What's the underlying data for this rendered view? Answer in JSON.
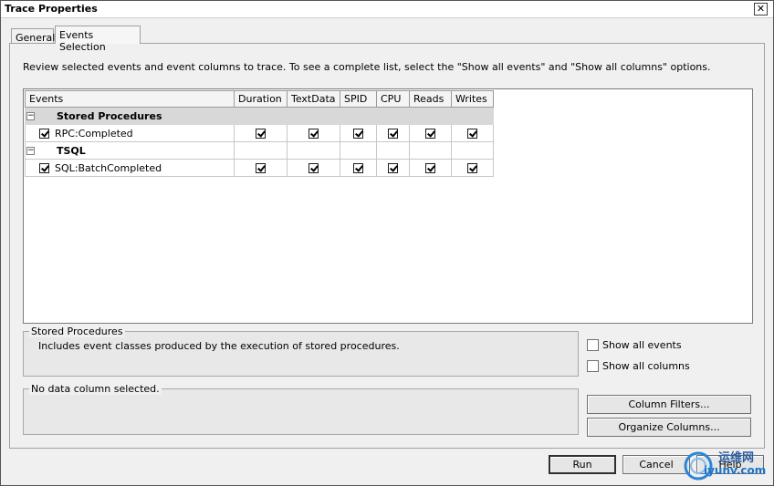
{
  "window": {
    "title": "Trace Properties",
    "close_glyph": "✕"
  },
  "tabs": [
    {
      "label": "General"
    },
    {
      "label": "Events Selection"
    }
  ],
  "intro_text": "Review selected events and event columns to trace. To see a complete list, select the \"Show all events\" and \"Show all columns\" options.",
  "grid": {
    "columns": [
      "Events",
      "Duration",
      "TextData",
      "SPID",
      "CPU",
      "Reads",
      "Writes"
    ],
    "groups": [
      {
        "label": "Stored Procedures",
        "collapse_glyph": "−",
        "events": [
          {
            "label": "RPC:Completed",
            "checked": true,
            "columns_checked": [
              true,
              true,
              true,
              true,
              true,
              true
            ]
          }
        ]
      },
      {
        "label": "TSQL",
        "collapse_glyph": "−",
        "events": [
          {
            "label": "SQL:BatchCompleted",
            "checked": true,
            "columns_checked": [
              true,
              true,
              true,
              true,
              true,
              true
            ]
          }
        ]
      }
    ]
  },
  "description_box": {
    "legend": "Stored Procedures",
    "text": "Includes event classes produced by the execution of stored procedures."
  },
  "column_box": {
    "legend": "No data column selected."
  },
  "options": {
    "show_all_events": {
      "label": "Show all events",
      "checked": false
    },
    "show_all_columns": {
      "label": "Show all columns",
      "checked": false
    }
  },
  "buttons": {
    "column_filters": "Column Filters...",
    "organize_columns": "Organize Columns...",
    "run": "Run",
    "cancel": "Cancel",
    "help": "Help"
  },
  "watermark": {
    "line1": "运维网",
    "line2": "iyunv.com"
  }
}
